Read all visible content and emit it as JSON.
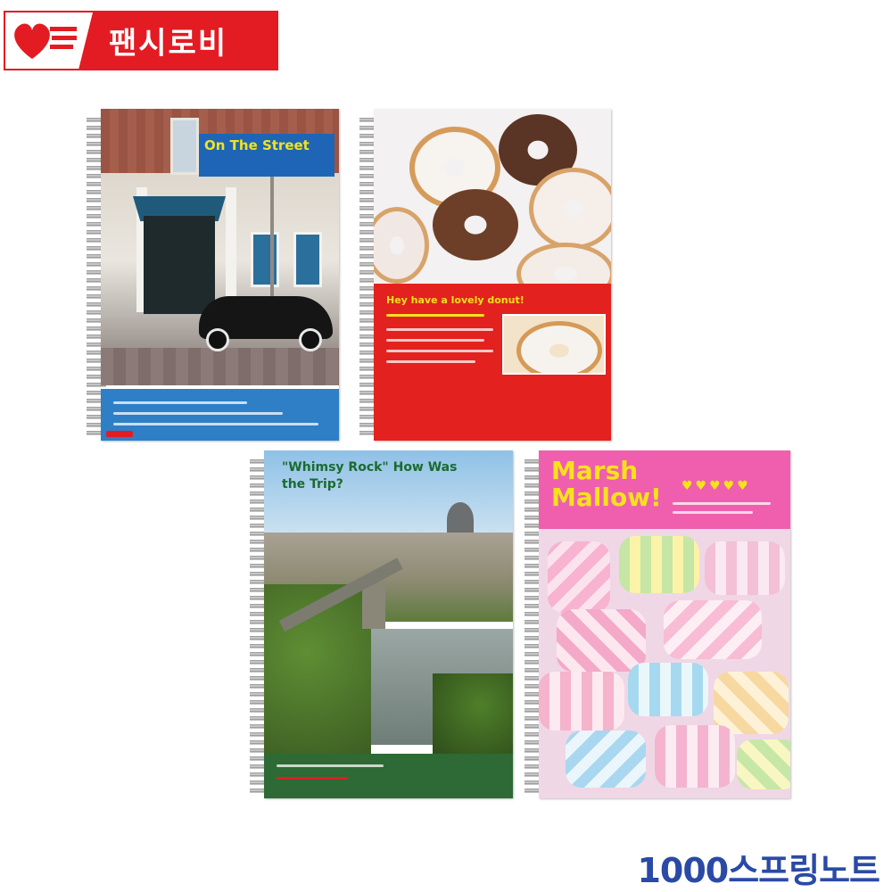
{
  "logo": {
    "text": "팬시로비",
    "brand_color": "#e31b23"
  },
  "notebooks": [
    {
      "id": "street",
      "title": "On The Street",
      "accent": "#2e7fc6"
    },
    {
      "id": "donut",
      "title": "Hey have a lovely donut!",
      "accent": "#e3211f"
    },
    {
      "id": "budapest",
      "title": "\"Whimsy Rock\" How Was the Trip?",
      "accent": "#2d6a35"
    },
    {
      "id": "marshmallow",
      "title": "Marsh Mallow!",
      "accent": "#ef5fae"
    }
  ],
  "caption": {
    "text": "1000스프링노트",
    "color": "#2a4aa5"
  }
}
